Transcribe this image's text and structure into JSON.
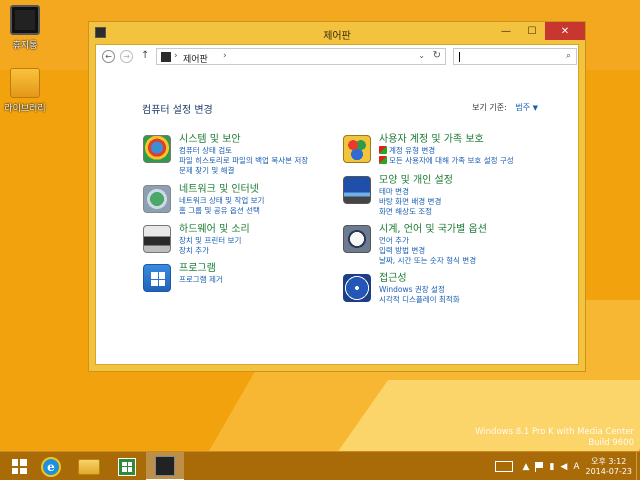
{
  "desktop": {
    "icons": [
      {
        "label": "휴지통"
      },
      {
        "label": "라이브러리"
      }
    ]
  },
  "window": {
    "title": "제어판",
    "buttons": {
      "minimize": "—",
      "maximize": "☐",
      "close": "✕"
    }
  },
  "addressbar": {
    "path": "제어판",
    "separator": "›",
    "search_placeholder": ""
  },
  "page": {
    "title": "컴퓨터 설정 변경",
    "view_by_label": "보기 기준:",
    "view_by_value": "범주"
  },
  "categories_left": [
    {
      "icon": "security-shield-icon",
      "heading": "시스템 및 보안",
      "links": [
        "컴퓨터 상태 검토",
        "파일 히스토리로 파일의 백업 복사본 저장",
        "문제 찾기 및 해결"
      ]
    },
    {
      "icon": "network-globe-icon",
      "heading": "네트워크 및 인터넷",
      "links": [
        "네트워크 상태 및 작업 보기",
        "홈 그룹 및 공유 옵션 선택"
      ]
    },
    {
      "icon": "printer-icon",
      "heading": "하드웨어 및 소리",
      "links": [
        "장치 및 프린터 보기",
        "장치 추가"
      ]
    },
    {
      "icon": "programs-icon",
      "heading": "프로그램",
      "links": [
        "프로그램 제거"
      ]
    }
  ],
  "categories_right": [
    {
      "icon": "users-family-icon",
      "heading": "사용자 계정 및 가족 보호",
      "links": [
        "계정 유형 변경",
        "모든 사용자에 대해 가족 보호 설정 구성"
      ]
    },
    {
      "icon": "appearance-monitor-icon",
      "heading": "모양 및 개인 설정",
      "links": [
        "테마 변경",
        "바탕 화면 배경 변경",
        "화면 해상도 조정"
      ]
    },
    {
      "icon": "clock-icon",
      "heading": "시계, 언어 및 국가별 옵션",
      "links": [
        "언어 추가",
        "입력 방법 변경",
        "날짜, 시간 또는 숫자 형식 변경"
      ]
    },
    {
      "icon": "accessibility-icon",
      "heading": "접근성",
      "links": [
        "Windows 권장 설정",
        "시각적 디스플레이 최적화"
      ]
    }
  ],
  "watermark": {
    "line1": "Windows 8.1 Pro K with Media Center",
    "line2": "Build 9600"
  },
  "taskbar": {
    "lang": "A",
    "time": "오후 3:12",
    "date": "2014-07-23"
  }
}
